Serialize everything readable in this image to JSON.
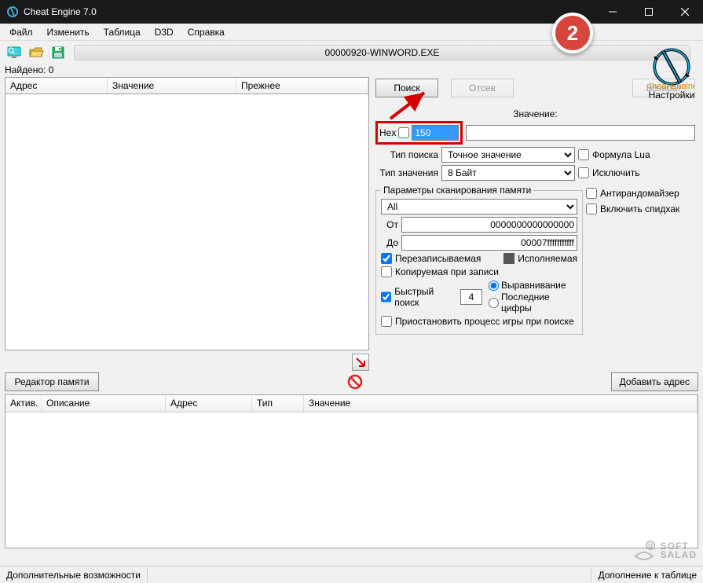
{
  "window": {
    "title": "Cheat Engine 7.0"
  },
  "menu": {
    "file": "Файл",
    "edit": "Изменить",
    "table": "Таблица",
    "d3d": "D3D",
    "help": "Справка"
  },
  "process_name": "00000920-WINWORD.EXE",
  "settings_label": "Настройки",
  "found_label": "Найдено: 0",
  "results_columns": {
    "address": "Адрес",
    "value": "Значение",
    "previous": "Прежнее"
  },
  "buttons": {
    "search": "Поиск",
    "filter": "Отсев",
    "undo": "Возврат",
    "mem_editor": "Редактор памяти",
    "add_address": "Добавить адрес"
  },
  "scan": {
    "value_label": "Значение:",
    "hex_label": "Hex",
    "value_input": "150",
    "scan_type_label": "Тип поиска",
    "scan_type_value": "Точное значение",
    "value_type_label": "Тип значения",
    "value_type_value": "8 Байт",
    "lua_formula": "Формула Lua",
    "exclude": "Исключить"
  },
  "memscan": {
    "legend": "Параметры сканирования памяти",
    "all": "All",
    "from_label": "От",
    "from_value": "0000000000000000",
    "to_label": "До",
    "to_value": "00007fffffffffff",
    "writable": "Перезаписываемая",
    "executable": "Исполняемая",
    "copy_on_write": "Копируемая при записи",
    "fast_scan": "Быстрый поиск",
    "fast_scan_value": "4",
    "alignment": "Выравнивание",
    "last_digits": "Последние цифры",
    "pause_game": "Приостановить процесс игры при поиске",
    "anti_randomizer": "Антирандомайзер",
    "speedhack": "Включить спидхак"
  },
  "address_list_columns": {
    "active": "Актив.",
    "description": "Описание",
    "address": "Адрес",
    "type": "Тип",
    "value": "Значение"
  },
  "status": {
    "left": "Дополнительные возможности",
    "right": "Дополнение к таблице"
  },
  "callout_number": "2",
  "watermark": "SOFT SALAD"
}
